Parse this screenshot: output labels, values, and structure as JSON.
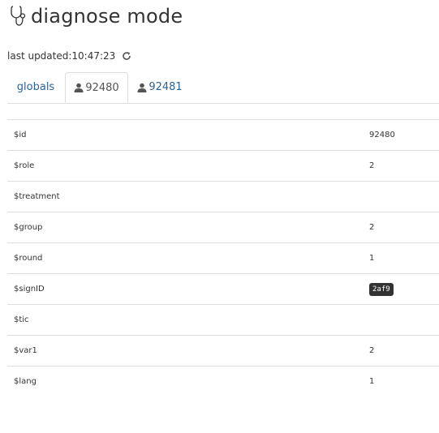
{
  "header": {
    "title": "diagnose mode",
    "icon": "stethoscope-icon"
  },
  "status": {
    "last_updated_label": "last updated:",
    "last_updated_time": "10:47:23",
    "refresh_icon": "refresh-icon"
  },
  "tabs": [
    {
      "label": "globals",
      "icon": null,
      "active": false
    },
    {
      "label": "92480",
      "icon": "user-icon",
      "active": true
    },
    {
      "label": "92481",
      "icon": "user-icon",
      "active": false
    }
  ],
  "variables": [
    {
      "name": "$id",
      "value": "92480"
    },
    {
      "name": "$role",
      "value": "2"
    },
    {
      "name": "$treatment",
      "value": ""
    },
    {
      "name": "$group",
      "value": "2"
    },
    {
      "name": "$round",
      "value": "1"
    },
    {
      "name": "$signID",
      "value": "2af9",
      "badge": true
    },
    {
      "name": "$tic",
      "value": ""
    },
    {
      "name": "$var1",
      "value": "2"
    },
    {
      "name": "$lang",
      "value": "1"
    }
  ],
  "colors": {
    "link": "#2a6496",
    "text": "#333333",
    "border": "#dddddd",
    "badge_bg": "#333333"
  }
}
